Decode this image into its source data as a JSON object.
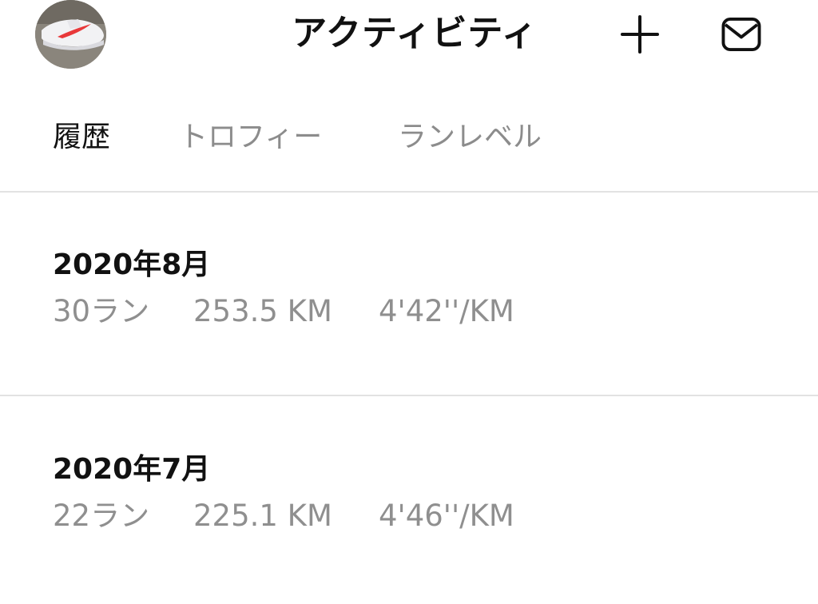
{
  "header": {
    "title": "アクティビティ",
    "avatar_icon": "sneaker-avatar",
    "add_icon": "plus-icon",
    "mail_icon": "mail-icon"
  },
  "tabs": [
    {
      "label": "履歴",
      "active": true
    },
    {
      "label": "トロフィー",
      "active": false
    },
    {
      "label": "ランレベル",
      "active": false
    }
  ],
  "history": [
    {
      "month": "2020年8月",
      "runs": "30ラン",
      "distance": "253.5 KM",
      "pace": "4'42''/KM"
    },
    {
      "month": "2020年7月",
      "runs": "22ラン",
      "distance": "225.1 KM",
      "pace": "4'46''/KM"
    }
  ],
  "colors": {
    "text_primary": "#111111",
    "text_secondary": "#8f8f8f",
    "divider": "#e2e2e2",
    "accent_swoosh": "#e8383a"
  }
}
